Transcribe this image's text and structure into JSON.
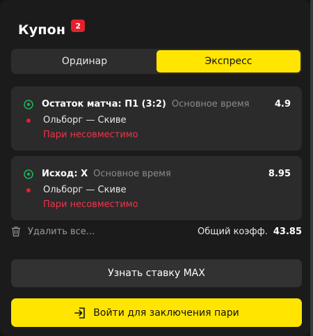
{
  "coupon": {
    "title": "Купон",
    "count": "2"
  },
  "tabs": [
    {
      "label": "Ординар",
      "active": false
    },
    {
      "label": "Экспресс",
      "active": true
    }
  ],
  "bets": [
    {
      "market": "Остаток матча: П1 (3:2)",
      "period": "Основное время",
      "odds": "4.9",
      "match": "Ольборг — Скиве",
      "warning": "Пари несовместимо"
    },
    {
      "market": "Исход: Х",
      "period": "Основное время",
      "odds": "8.95",
      "match": "Ольборг — Скиве",
      "warning": "Пари несовместимо"
    }
  ],
  "footer": {
    "delete_label": "Удалить все...",
    "total_label": "Общий коэфф.",
    "total_value": "43.85"
  },
  "buttons": {
    "max_stake": "Узнать ставку MAX",
    "login": "Войти для заключения пари"
  },
  "colors": {
    "accent": "#ffe500",
    "danger": "#e4202d",
    "warning_text": "#f0334b",
    "sport_icon": "#23b05a"
  }
}
